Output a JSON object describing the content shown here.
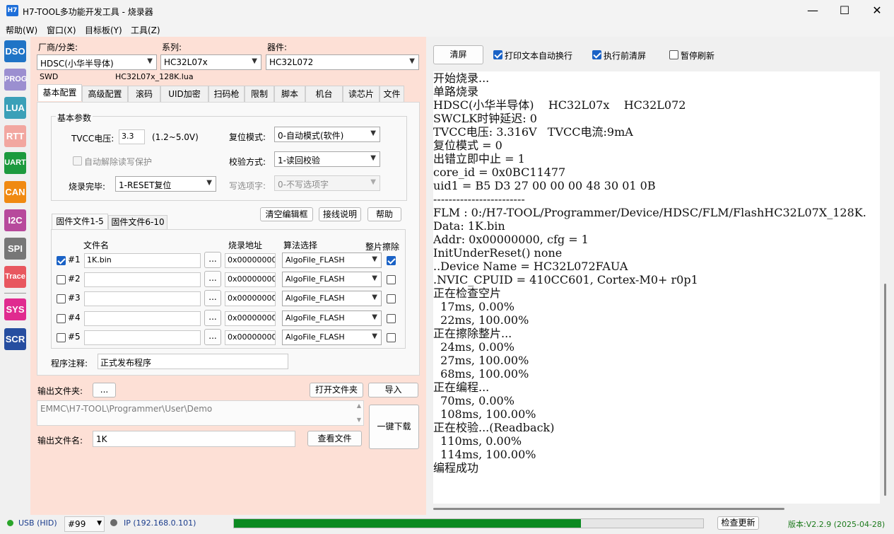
{
  "window": {
    "icon": "H7",
    "title": "H7-TOOL多功能开发工具 - 烧录器",
    "minimize": "—",
    "maximize": "☐",
    "close": "✕"
  },
  "menu": [
    "帮助(W)",
    "窗口(X)",
    "目标板(Y)",
    "工具(Z)"
  ],
  "sidebar": [
    {
      "label": "DSO",
      "color": "#1f74c6"
    },
    {
      "label": "PROG",
      "color": "#9b8fd0"
    },
    {
      "label": "LUA",
      "color": "#3aa0b8"
    },
    {
      "label": "RTT",
      "color": "#f2a7a0"
    },
    {
      "label": "UART",
      "color": "#1c9a3e"
    },
    {
      "label": "CAN",
      "color": "#f08a12"
    },
    {
      "label": "I2C",
      "color": "#b74a9c"
    },
    {
      "label": "SPI",
      "color": "#777777"
    },
    {
      "label": "Trace",
      "color": "#e8575f"
    },
    {
      "label": "SYS",
      "color": "#e02b8f"
    },
    {
      "label": "SCR",
      "color": "#264ea0"
    }
  ],
  "device": {
    "vendor_label": "厂商/分类:",
    "vendor_value": "HDSC(小华半导体)",
    "series_label": "系列:",
    "series_value": "HC32L07x",
    "part_label": "器件:",
    "part_value": "HC32L072",
    "interface": "SWD",
    "lua_file": "HC32L07x_128K.lua"
  },
  "tabs": [
    "基本配置",
    "高级配置",
    "滚码",
    "UID加密",
    "扫码枪",
    "限制",
    "脚本",
    "机台",
    "读芯片",
    "文件"
  ],
  "basic": {
    "group_title": "基本参数",
    "tvcc_label": "TVCC电压:",
    "tvcc_value": "3.3",
    "tvcc_range": "(1.2~5.0V)",
    "auto_unlock": "自动解除读写保护",
    "done_label": "烧录完毕:",
    "done_value": "1-RESET复位",
    "reset_label": "复位模式:",
    "reset_value": "0-自动模式(软件)",
    "verify_label": "校验方式:",
    "verify_value": "1-读回校验",
    "wopt_label": "写选项字:",
    "wopt_value": "0-不写选项字"
  },
  "file_buttons": {
    "clear_edit": "清空编辑框",
    "wiring": "接线说明",
    "help": "帮助"
  },
  "file_tabs": [
    "固件文件1-5",
    "固件文件6-10"
  ],
  "file_headers": {
    "name": "文件名",
    "addr": "烧录地址",
    "algo": "算法选择",
    "erase": "整片擦除"
  },
  "files": [
    {
      "idx": "#1",
      "name": "1K.bin",
      "browse": "...",
      "addr": "0x00000000",
      "algo": "AlgoFile_FLASH"
    },
    {
      "idx": "#2",
      "name": "",
      "browse": "...",
      "addr": "0x00000000",
      "algo": "AlgoFile_FLASH"
    },
    {
      "idx": "#3",
      "name": "",
      "browse": "...",
      "addr": "0x00000000",
      "algo": "AlgoFile_FLASH"
    },
    {
      "idx": "#4",
      "name": "",
      "browse": "...",
      "addr": "0x00000000",
      "algo": "AlgoFile_FLASH"
    },
    {
      "idx": "#5",
      "name": "",
      "browse": "...",
      "addr": "0x00000000",
      "algo": "AlgoFile_FLASH"
    }
  ],
  "note": {
    "label": "程序注释:",
    "value": "正式发布程序"
  },
  "output": {
    "folder_label": "输出文件夹:",
    "browse": "...",
    "open_folder": "打开文件夹",
    "import": "导入",
    "path": "EMMC\\H7-TOOL\\Programmer\\User\\Demo",
    "name_label": "输出文件名:",
    "name_value": "1K",
    "view_file": "查看文件",
    "one_key": "一键下载"
  },
  "console_toolbar": {
    "clear": "清屏",
    "wrap": "打印文本自动换行",
    "clear_before": "执行前清屏",
    "pause": "暂停刷新"
  },
  "console_lines": [
    "开始烧录...",
    "单路烧录",
    "HDSC(小华半导体)    HC32L07x    HC32L072",
    "SWCLK时钟延迟: 0",
    "TVCC电压: 3.316V   TVCC电流:9mA",
    "复位模式 = 0",
    "出错立即中止 = 1",
    "core_id = 0x0BC11477",
    "uid1 = B5 D3 27 00 00 00 48 30 01 0B",
    "------------------------",
    "FLM : 0:/H7-TOOL/Programmer/Device/HDSC/FLM/FlashHC32L07X_128K.",
    "Data: 1K.bin",
    "Addr: 0x00000000, cfg = 1",
    "InitUnderReset() none",
    "..Device Name = HC32L072FAUA",
    ".NVIC_CPUID = 410CC601, Cortex-M0+ r0p1",
    "正在检查空片",
    "  17ms, 0.00%",
    "  22ms, 100.00%",
    "正在擦除整片...",
    "  24ms, 0.00%",
    "  27ms, 100.00%",
    "  68ms, 100.00%",
    "正在编程...",
    "  70ms, 0.00%",
    "  108ms, 100.00%",
    "正在校验...(Readback)",
    "  110ms, 0.00%",
    "  114ms, 100.00%",
    "编程成功"
  ],
  "status": {
    "usb": "USB (HID)",
    "port": "#99",
    "ip": "IP (192.168.0.101)",
    "progress": 0.74,
    "check_update": "检查更新",
    "version": "版本:V2.2.9 (2025-04-28)"
  }
}
